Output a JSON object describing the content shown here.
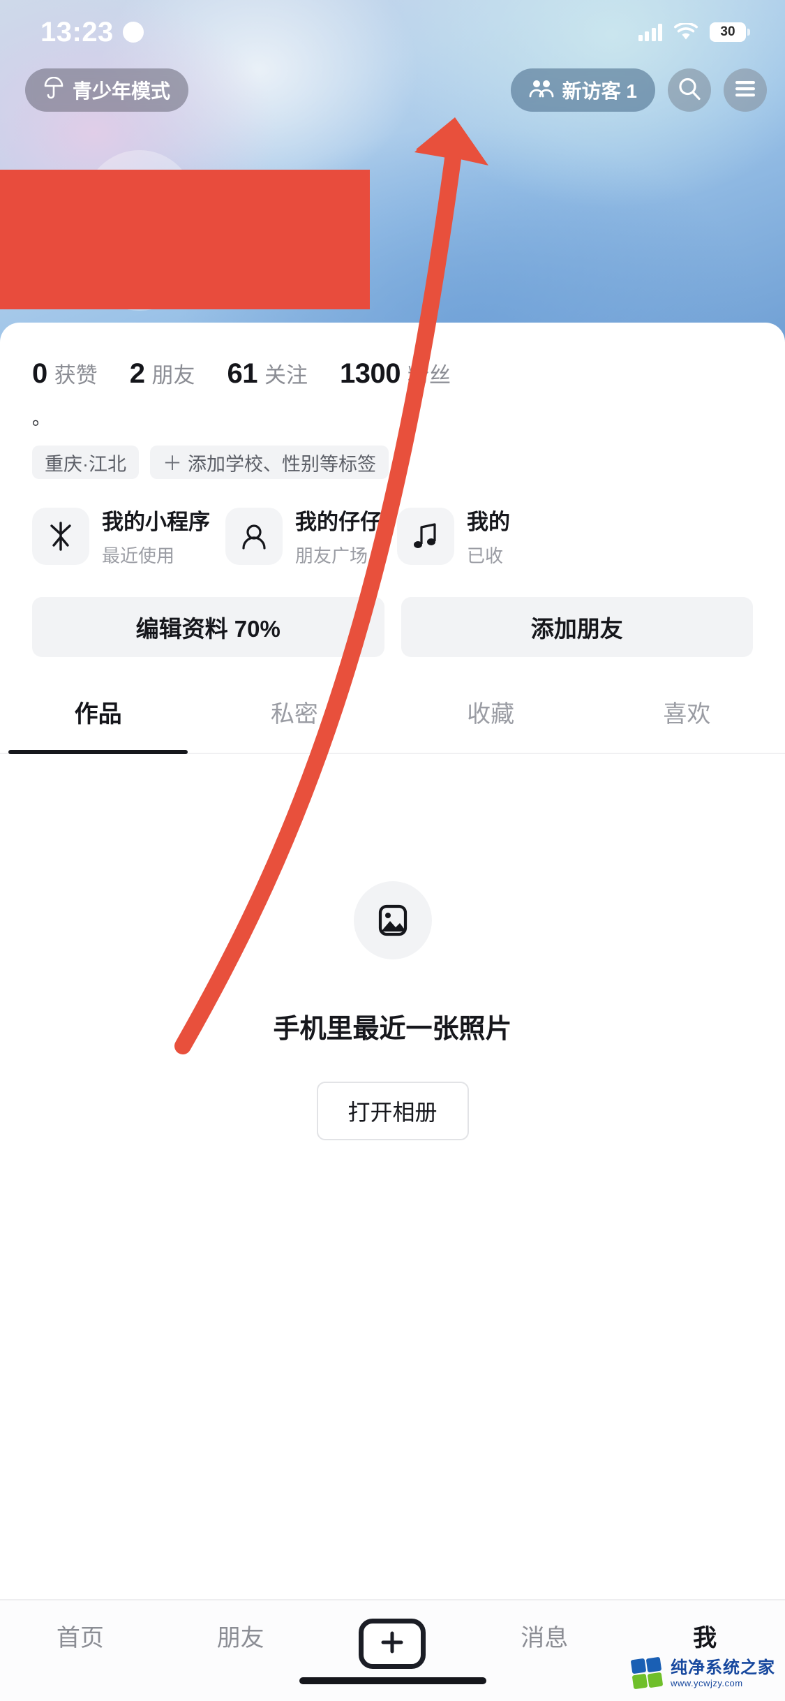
{
  "status_bar": {
    "time": "13:23",
    "moon_icon": "crescent-moon-icon",
    "signal_icon": "cellular-signal-icon",
    "wifi_icon": "wifi-icon",
    "battery_level": "30"
  },
  "header": {
    "teen_mode": {
      "label": "青少年模式",
      "icon": "umbrella-icon"
    },
    "visitor": {
      "label": "新访客 1",
      "icon": "people-icon"
    },
    "search": {
      "icon": "search-icon"
    },
    "menu": {
      "icon": "hamburger-menu-icon"
    }
  },
  "profile": {
    "stats": [
      {
        "value": "0",
        "label": "获赞"
      },
      {
        "value": "2",
        "label": "朋友"
      },
      {
        "value": "61",
        "label": "关注"
      },
      {
        "value": "1300",
        "label": "粉丝"
      }
    ],
    "bio": "。",
    "tags": [
      {
        "label": "重庆·江北",
        "has_plus": false
      },
      {
        "label": "添加学校、性别等标签",
        "has_plus": true,
        "plus": "＋"
      }
    ],
    "cards": [
      {
        "title": "我的小程序",
        "subtitle": "最近使用",
        "icon": "douyin-logo-icon"
      },
      {
        "title": "我的仔仔",
        "subtitle": "朋友广场",
        "icon": "avatar-icon"
      },
      {
        "title": "我的",
        "subtitle": "已收",
        "icon": "music-note-icon"
      }
    ],
    "actions": [
      {
        "label": "编辑资料 70%"
      },
      {
        "label": "添加朋友"
      }
    ]
  },
  "tabs": [
    {
      "label": "作品",
      "active": true
    },
    {
      "label": "私密",
      "active": false
    },
    {
      "label": "收藏",
      "active": false
    },
    {
      "label": "喜欢",
      "active": false
    }
  ],
  "empty_state": {
    "icon": "photo-image-icon",
    "title": "手机里最近一张照片",
    "button_label": "打开相册"
  },
  "bottom_nav": [
    {
      "label": "首页",
      "active": false
    },
    {
      "label": "朋友",
      "active": false
    },
    {
      "label": "",
      "active": false,
      "icon": "plus-create-icon"
    },
    {
      "label": "消息",
      "active": false
    },
    {
      "label": "我",
      "active": true
    }
  ],
  "annotation": {
    "arrow_color": "#e8503c",
    "redaction_color": "#e84c3d"
  },
  "watermark": {
    "name": "纯净系统之家",
    "url": "www.ycwjzy.com"
  }
}
